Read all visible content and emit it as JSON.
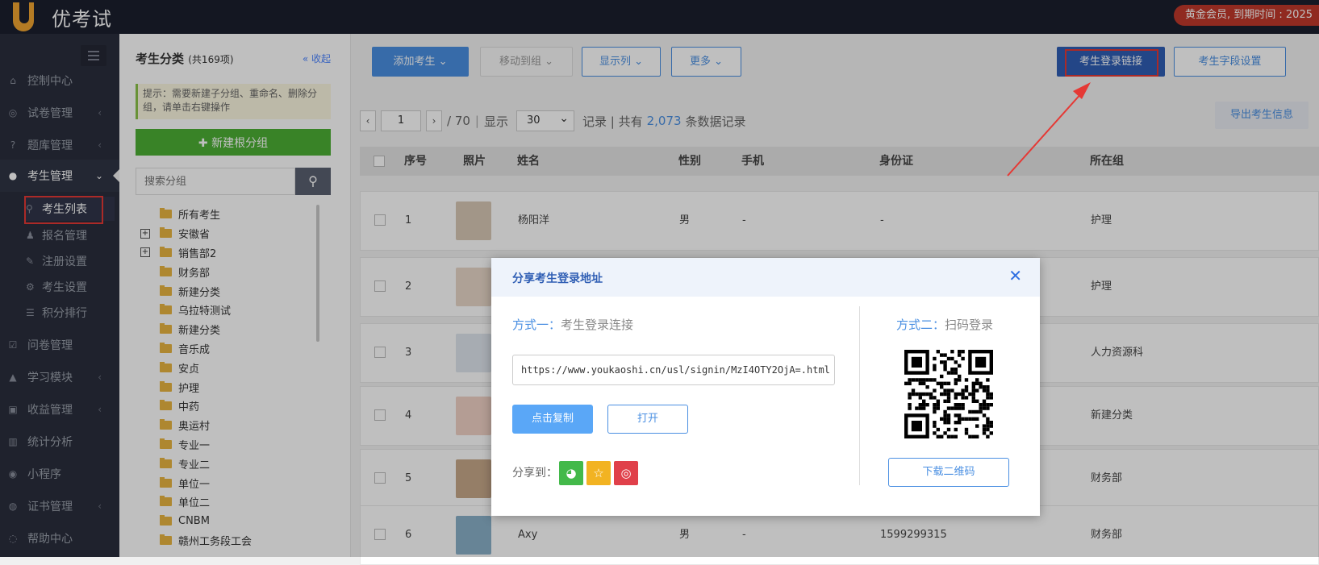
{
  "app": {
    "name": "优考试",
    "member_badge": "黄金会员, 到期时间 : 2025"
  },
  "sidebar": {
    "items": [
      {
        "label": "控制中心",
        "icon": "home-icon"
      },
      {
        "label": "试卷管理",
        "icon": "check-circle-icon"
      },
      {
        "label": "题库管理",
        "icon": "question-icon"
      },
      {
        "label": "考生管理",
        "icon": "user-icon"
      },
      {
        "label": "问卷管理",
        "icon": "checkbox-icon"
      },
      {
        "label": "学习模块",
        "icon": "graduation-icon"
      },
      {
        "label": "收益管理",
        "icon": "money-icon"
      },
      {
        "label": "统计分析",
        "icon": "bar-chart-icon"
      },
      {
        "label": "小程序",
        "icon": "wechat-icon"
      },
      {
        "label": "证书管理",
        "icon": "certificate-icon"
      },
      {
        "label": "帮助中心",
        "icon": "help-icon"
      }
    ],
    "subitems": [
      {
        "label": "考生列表"
      },
      {
        "label": "报名管理"
      },
      {
        "label": "注册设置"
      },
      {
        "label": "考生设置"
      },
      {
        "label": "积分排行"
      }
    ]
  },
  "categories": {
    "title": "考生分类",
    "count": "(共169项)",
    "collapse": "收起",
    "hint": "提示：需要新建子分组、重命名、删除分组，请单击右键操作",
    "new_root": "新建根分组",
    "search_placeholder": "搜索分组",
    "tree": [
      {
        "label": "所有考生",
        "expandable": false
      },
      {
        "label": "安徽省",
        "expandable": true
      },
      {
        "label": "销售部2",
        "expandable": true
      },
      {
        "label": "财务部",
        "expandable": false
      },
      {
        "label": "新建分类",
        "expandable": false
      },
      {
        "label": "乌拉特测试",
        "expandable": false
      },
      {
        "label": "新建分类",
        "expandable": false
      },
      {
        "label": "音乐成",
        "expandable": false
      },
      {
        "label": "安贞",
        "expandable": false
      },
      {
        "label": "护理",
        "expandable": false
      },
      {
        "label": "中药",
        "expandable": false
      },
      {
        "label": "奥运村",
        "expandable": false
      },
      {
        "label": "专业一",
        "expandable": false
      },
      {
        "label": "专业二",
        "expandable": false
      },
      {
        "label": "单位一",
        "expandable": false
      },
      {
        "label": "单位二",
        "expandable": false
      },
      {
        "label": "CNBM",
        "expandable": false
      },
      {
        "label": "赣州工务段工会",
        "expandable": false
      }
    ]
  },
  "toolbar": {
    "add": "添加考生 ⌄",
    "move": "移动到组 ⌄",
    "columns": "显示列 ⌄",
    "more": "更多 ⌄",
    "login_link": "考生登录链接",
    "field_settings": "考生字段设置",
    "export": "导出考生信息"
  },
  "pager": {
    "page": "1",
    "total_pages": "/ 70",
    "show_label": "显示",
    "per_page": "30",
    "records_prefix": "记录 | 共有",
    "total": "2,073",
    "records_suffix": "条数据记录"
  },
  "table": {
    "headers": [
      "序号",
      "照片",
      "姓名",
      "性别",
      "手机",
      "身份证",
      "所在组"
    ],
    "rows": [
      {
        "no": "1",
        "name": "杨阳洋",
        "gender": "男",
        "phone": "-",
        "id": "-",
        "group": "护理"
      },
      {
        "no": "2",
        "name": "",
        "gender": "",
        "phone": "",
        "id": "",
        "group": "护理"
      },
      {
        "no": "3",
        "name": "",
        "gender": "",
        "phone": "",
        "id": "",
        "group": "人力资源科"
      },
      {
        "no": "4",
        "name": "",
        "gender": "",
        "phone": "",
        "id": "",
        "group": "新建分类"
      },
      {
        "no": "5",
        "name": "",
        "gender": "",
        "phone": "",
        "id": "",
        "group": "财务部"
      },
      {
        "no": "6",
        "name": "Axy",
        "gender": "男",
        "phone": "-",
        "id": "1599299315",
        "group": "财务部"
      }
    ]
  },
  "modal": {
    "title": "分享考生登录地址",
    "method1_prefix": "方式一：",
    "method1": "考生登录连接",
    "url": "https://www.youkaoshi.cn/usl/signin/MzI4OTY2OjA=.html",
    "copy": "点击复制",
    "open": "打开",
    "share_to": "分享到：",
    "method2_prefix": "方式二：",
    "method2": "扫码登录",
    "download_qr": "下载二维码"
  },
  "colors": {
    "accent": "#4a8fe2",
    "sidebar_bg": "#2a2e3c",
    "topbar_bg": "#1b1f2e",
    "highlight": "#e53935"
  }
}
